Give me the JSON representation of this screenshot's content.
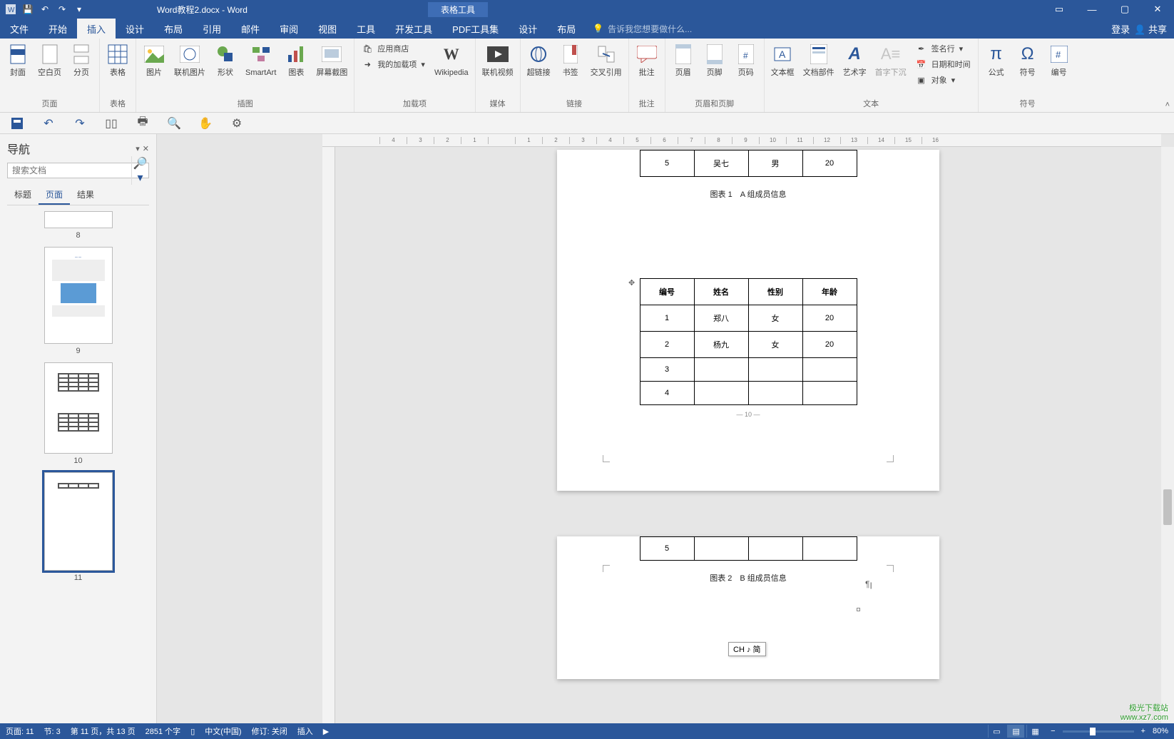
{
  "title": "Word教程2.docx - Word",
  "contextual_tab": "表格工具",
  "tabs": [
    "文件",
    "开始",
    "插入",
    "设计",
    "布局",
    "引用",
    "邮件",
    "审阅",
    "视图",
    "工具",
    "开发工具",
    "PDF工具集"
  ],
  "context_tabs": [
    "设计",
    "布局"
  ],
  "active_tab": "插入",
  "tell_me": "告诉我您想要做什么...",
  "login": "登录",
  "share": "共享",
  "ribbon": {
    "pages": {
      "label": "页面",
      "cover": "封面",
      "blank": "空白页",
      "break": "分页"
    },
    "tables": {
      "label": "表格",
      "table": "表格"
    },
    "illus": {
      "label": "插图",
      "pic": "图片",
      "online": "联机图片",
      "shapes": "形状",
      "smartart": "SmartArt",
      "chart": "图表",
      "screenshot": "屏幕截图"
    },
    "addins": {
      "label": "加载项",
      "store": "应用商店",
      "myaddins": "我的加载项",
      "wikipedia": "Wikipedia"
    },
    "media": {
      "label": "媒体",
      "video": "联机视频"
    },
    "links": {
      "label": "链接",
      "hyperlink": "超链接",
      "bookmark": "书签",
      "crossref": "交叉引用"
    },
    "comments": {
      "label": "批注",
      "comment": "批注"
    },
    "headerfooter": {
      "label": "页眉和页脚",
      "header": "页眉",
      "footer": "页脚",
      "pagenum": "页码"
    },
    "text": {
      "label": "文本",
      "textbox": "文本框",
      "quickparts": "文档部件",
      "wordart": "艺术字",
      "dropcap": "首字下沉",
      "sig": "签名行",
      "datetime": "日期和时间",
      "object": "对象"
    },
    "symbols": {
      "label": "符号",
      "equation": "公式",
      "symbol": "符号",
      "number": "编号"
    }
  },
  "nav": {
    "title": "导航",
    "search_placeholder": "搜索文档",
    "tabs": [
      "标题",
      "页面",
      "结果"
    ],
    "active_tab": "页面",
    "thumbs": [
      8,
      9,
      10,
      11
    ],
    "selected": 11
  },
  "doc": {
    "table_top_row": [
      "5",
      "吴七",
      "男",
      "20"
    ],
    "caption1": "图表 1　A 组成员信息",
    "tableB_headers": [
      "编号",
      "姓名",
      "性别",
      "年龄"
    ],
    "tableB_rows": [
      [
        "1",
        "郑八",
        "女",
        "20"
      ],
      [
        "2",
        "杨九",
        "女",
        "20"
      ],
      [
        "3",
        "",
        "",
        ""
      ],
      [
        "4",
        "",
        "",
        ""
      ]
    ],
    "page_num_10": "— 10 —",
    "table_bottom_row": [
      "5",
      "",
      "",
      ""
    ],
    "caption2": "图表 2　B 组成员信息"
  },
  "ime": "CH ♪ 简",
  "status": {
    "page": "页面: 11",
    "section": "节: 3",
    "pageof": "第 11 页，共 13 页",
    "words": "2851 个字",
    "lang": "中文(中国)",
    "track": "修订: 关闭",
    "mode": "插入",
    "zoom": "80%"
  },
  "watermark": {
    "l1": "极光下载站",
    "l2": "www.xz7.com"
  }
}
